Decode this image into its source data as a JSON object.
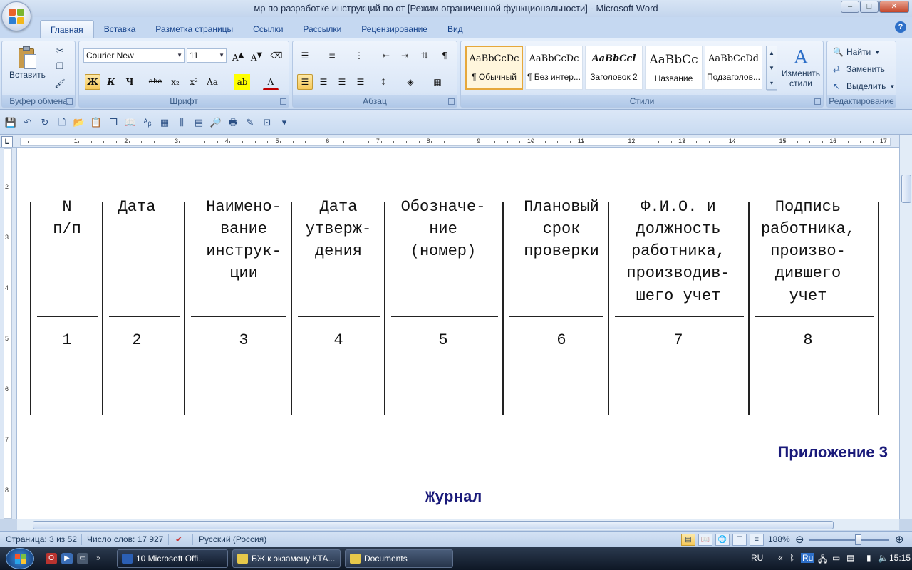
{
  "window": {
    "title": "мр по разработке инструкций по от [Режим ограниченной функциональности] - Microsoft Word",
    "controls": [
      "–",
      "□",
      "✕"
    ]
  },
  "ribbon": {
    "tabs": [
      "Главная",
      "Вставка",
      "Разметка страницы",
      "Ссылки",
      "Рассылки",
      "Рецензирование",
      "Вид"
    ],
    "active_tab": "Главная",
    "groups": {
      "clipboard": {
        "label": "Буфер обмена",
        "paste": "Вставить"
      },
      "font": {
        "label": "Шрифт",
        "font_name": "Courier New",
        "font_size": "11"
      },
      "paragraph": {
        "label": "Абзац"
      },
      "styles": {
        "label": "Стили",
        "items": [
          {
            "sample": "AaBbCcDc",
            "name": "¶ Обычный"
          },
          {
            "sample": "AaBbCcDc",
            "name": "¶ Без интер..."
          },
          {
            "sample": "AaBbCcl",
            "name": "Заголовок 2"
          },
          {
            "sample": "AaBbCc",
            "name": "Название"
          },
          {
            "sample": "AaBbCcDd",
            "name": "Подзаголов..."
          }
        ],
        "change": "Изменить стили"
      },
      "editing": {
        "label": "Редактирование",
        "find": "Найти",
        "replace": "Заменить",
        "select": "Выделить"
      }
    }
  },
  "document": {
    "header_rows": [
      [
        "N",
        "Дата",
        "Наимено-",
        "Дата",
        "Обозначе-",
        "Плановый",
        "Ф.И.О. и",
        "Подпись"
      ],
      [
        "п/п",
        "",
        "вание",
        "утверж-",
        "ние",
        "срок",
        "должность",
        "работника,"
      ],
      [
        "",
        "",
        "инструк-",
        "дения",
        "(номер)",
        "проверки",
        "работника,",
        "произво-"
      ],
      [
        "",
        "",
        "ции",
        "",
        "",
        "",
        "производив-",
        "дившего"
      ],
      [
        "",
        "",
        "",
        "",
        "",
        "",
        "шего учет",
        "учет"
      ]
    ],
    "number_row": [
      "1",
      "2",
      "3",
      "4",
      "5",
      "6",
      "7",
      "8"
    ],
    "appendix": "Приложение 3",
    "journal": "Журнал"
  },
  "status": {
    "page": "Страница: 3 из 52",
    "words": "Число слов: 17 927",
    "language": "Русский (Россия)",
    "zoom": "188%"
  },
  "taskbar": {
    "tasks": [
      "10 Microsoft Offi...",
      "БЖ к экзамену КТА...",
      "Documents"
    ],
    "lang": "RU",
    "tray_lang": "Ru",
    "clock": "15:15"
  }
}
